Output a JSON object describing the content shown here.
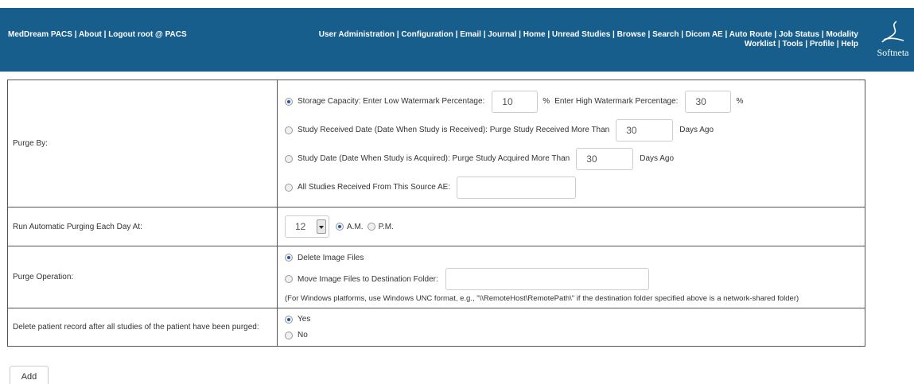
{
  "header": {
    "brand": "MedDream PACS",
    "about": "About",
    "logout": "Logout root @ PACS",
    "nav": [
      "User Administration",
      "Configuration",
      "Email",
      "Journal",
      "Home",
      "Unread Studies",
      "Browse",
      "Search",
      "Dicom AE",
      "Auto Route",
      "Job Status",
      "Modality Worklist",
      "Tools",
      "Profile",
      "Help"
    ],
    "logo_text": "Softneta"
  },
  "purge_by": {
    "label": "Purge By:",
    "storage": {
      "selected": true,
      "text": "Storage Capacity:  Enter Low Watermark Percentage:",
      "low_value": "10",
      "pct1": "%",
      "high_text": "Enter High Watermark Percentage:",
      "high_value": "30",
      "pct2": "%"
    },
    "received": {
      "selected": false,
      "text": "Study Received Date (Date When Study is Received):  Purge Study Received More Than",
      "value": "30",
      "suffix": "Days Ago"
    },
    "acquired": {
      "selected": false,
      "text": "Study Date (Date When Study is Acquired):  Purge Study Acquired More Than",
      "value": "30",
      "suffix": "Days Ago"
    },
    "source_ae": {
      "selected": false,
      "text": "All Studies Received From This Source AE:",
      "value": ""
    }
  },
  "schedule": {
    "label": "Run Automatic Purging Each Day At:",
    "hour": "12",
    "am_label": "A.M.",
    "pm_label": "P.M.",
    "am_selected": true
  },
  "operation": {
    "label": "Purge Operation:",
    "delete_label": "Delete Image Files",
    "delete_selected": true,
    "move_label": "Move Image Files to Destination Folder:",
    "move_value": "",
    "note": "(For Windows platforms, use Windows UNC format, e.g., \"\\\\RemoteHost\\RemotePath\\\" if the destination folder specified above is a network-shared folder)"
  },
  "delete_patient": {
    "label": "Delete patient record after all studies of the patient have been purged:",
    "yes_label": "Yes",
    "no_label": "No",
    "yes_selected": true
  },
  "add_button": "Add"
}
